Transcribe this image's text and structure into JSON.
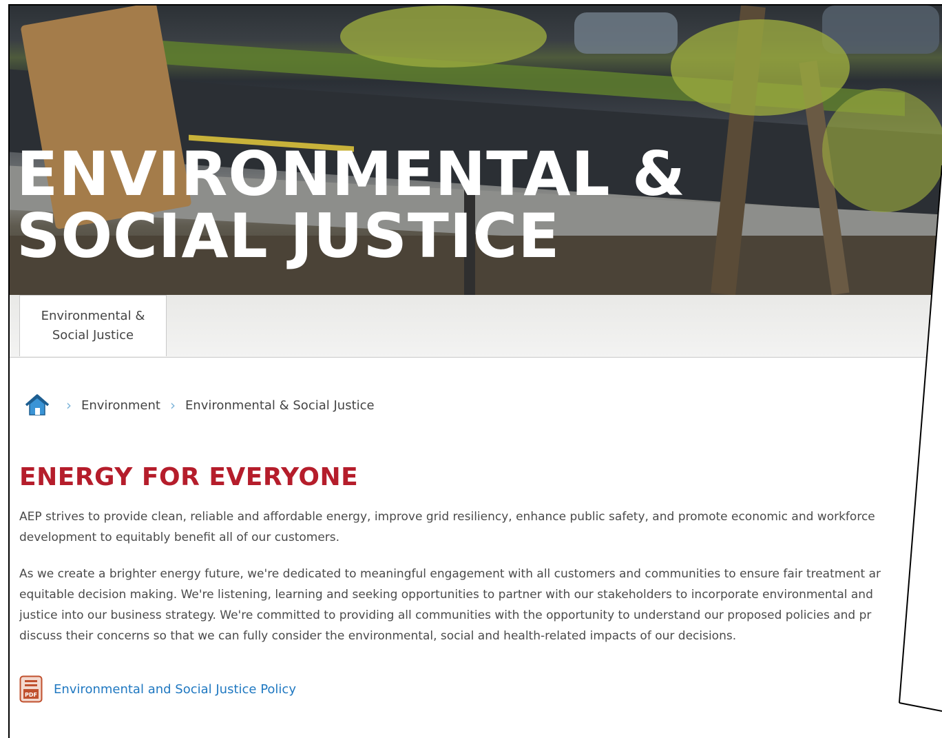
{
  "hero": {
    "title_line1": "ENVIRONMENTAL &",
    "title_line2": "SOCIAL JUSTICE"
  },
  "subnav": {
    "active_tab_line1": "Environmental &",
    "active_tab_line2": "Social Justice"
  },
  "breadcrumb": {
    "home_icon": "home-icon",
    "items": [
      "Environment",
      "Environmental & Social Justice"
    ]
  },
  "content": {
    "heading": "ENERGY FOR EVERYONE",
    "paragraph1_line1": "AEP strives to provide clean, reliable and affordable energy, improve grid resiliency, enhance public safety, and promote economic and workforce",
    "paragraph1_line2": "development to equitably benefit all of our customers.",
    "paragraph2_line1": "As we create a brighter energy future, we're dedicated to meaningful engagement with all customers and communities to ensure fair treatment ar",
    "paragraph2_line2": "equitable decision making. We're listening, learning and seeking opportunities to partner with our stakeholders to incorporate environmental and",
    "paragraph2_line3": "justice into our business strategy. We're committed to providing all communities with the opportunity to understand our proposed policies and pr",
    "paragraph2_line4": "discuss their concerns so that we can fully consider the environmental, social and health-related impacts of our decisions.",
    "pdf_link": "Environmental and Social Justice Policy",
    "pdf_icon": "pdf-icon"
  },
  "colors": {
    "heading": "#b51d2b",
    "link": "#1f78c1",
    "breadcrumb_separator": "#7bb3d8"
  }
}
